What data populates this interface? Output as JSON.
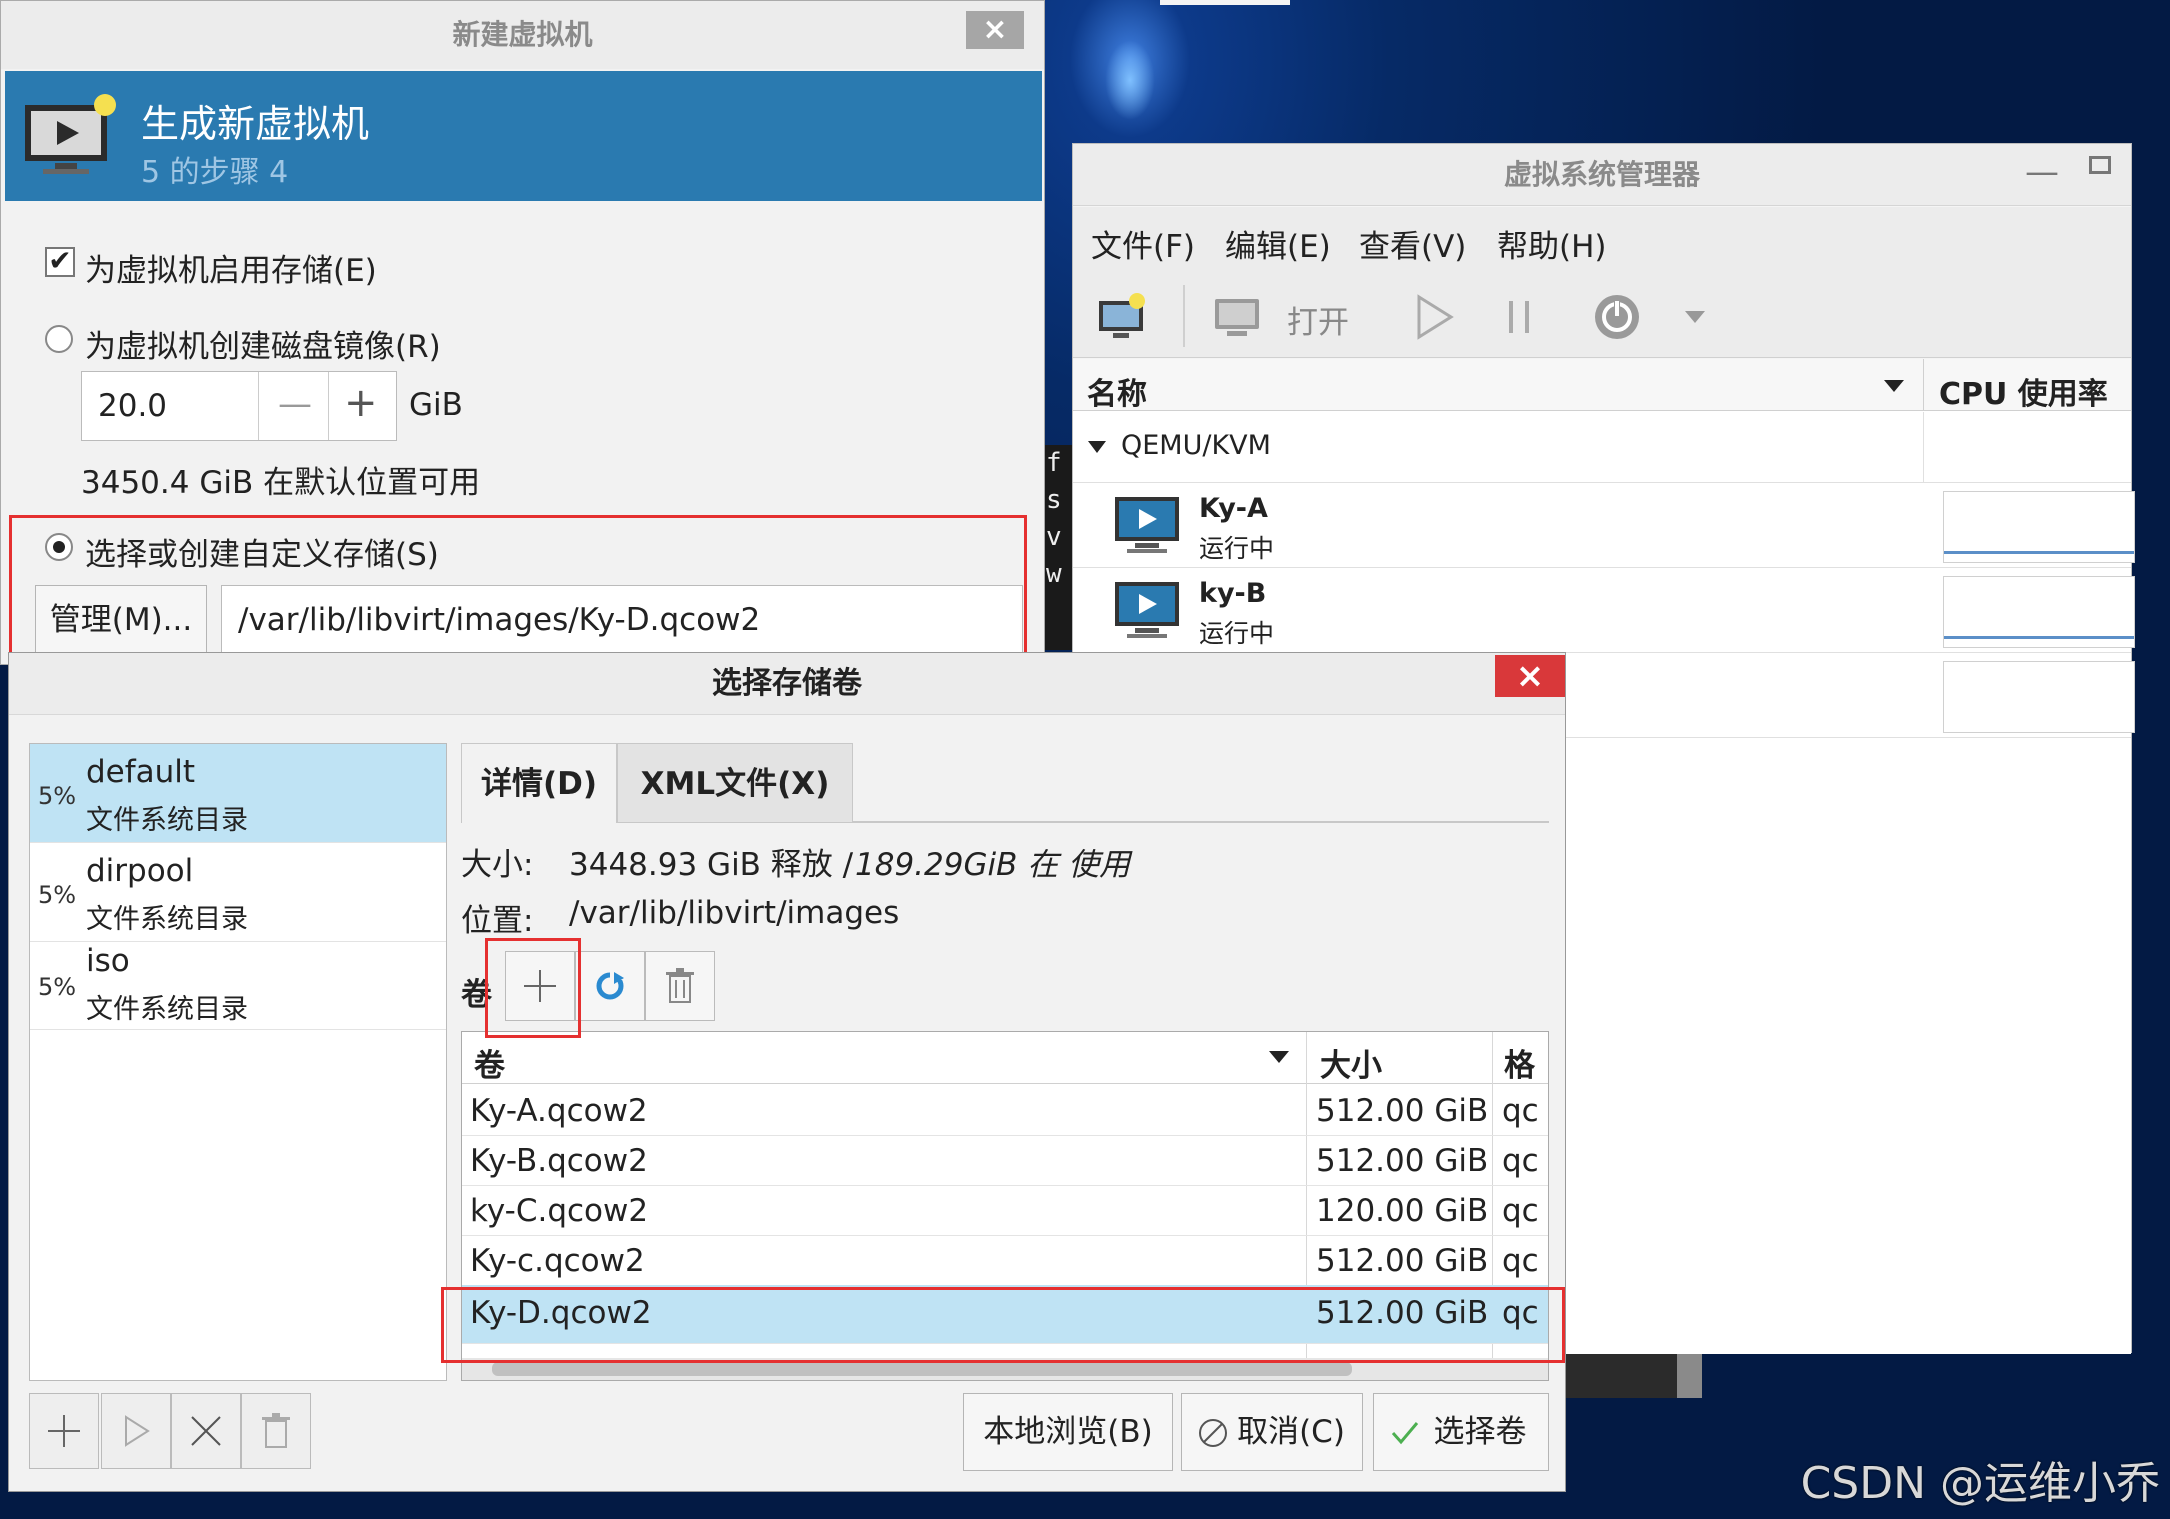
{
  "watermark": "CSDN @运维小乔",
  "terminal_chars": [
    "f",
    "s",
    "v",
    "w"
  ],
  "vmm": {
    "title": "虚拟系统管理器",
    "menu": [
      "文件(F)",
      "编辑(E)",
      "查看(V)",
      "帮助(H)"
    ],
    "toolbar": {
      "open_label": "打开"
    },
    "columns": {
      "name": "名称",
      "cpu": "CPU 使用率"
    },
    "group": "QEMU/KVM",
    "vms": [
      {
        "name": "Ky-A",
        "status": "运行中"
      },
      {
        "name": "ky-B",
        "status": "运行中"
      }
    ]
  },
  "newvm": {
    "title": "新建虚拟机",
    "close_glyph": "×",
    "banner_title": "生成新虚拟机",
    "banner_subtitle": "5 的步骤 4",
    "enable_storage_label": "为虚拟机启用存储(E)",
    "enable_storage_checked": true,
    "create_disk_label": "为虚拟机创建磁盘镜像(R)",
    "disk_size": "20.0",
    "disk_unit": "GiB",
    "available": "3450.4 GiB 在默认位置可用",
    "custom_storage_label": "选择或创建自定义存储(S)",
    "manage_button": "管理(M)...",
    "custom_path": "/var/lib/libvirt/images/Ky-D.qcow2"
  },
  "storage": {
    "title": "选择存储卷",
    "close_glyph": "×",
    "pools": [
      {
        "pct": "5%",
        "name": "default",
        "type": "文件系统目录",
        "selected": true
      },
      {
        "pct": "5%",
        "name": "dirpool",
        "type": "文件系统目录",
        "selected": false
      },
      {
        "pct": "5%",
        "name": "iso",
        "type": "文件系统目录",
        "selected": false
      }
    ],
    "tabs": {
      "details": "详情(D)",
      "xml": "XML文件(X)"
    },
    "size_label": "大小:",
    "size_free": "3448.93 GiB 释放 /",
    "size_used": "189.29GiB 在 使用",
    "location_label": "位置:",
    "location_value": "/var/lib/libvirt/images",
    "volumes_label": "卷",
    "columns": {
      "volume": "卷",
      "size": "大小",
      "format": "格"
    },
    "volumes": [
      {
        "name": "Ky-A.qcow2",
        "size": "512.00 GiB",
        "format": "qc"
      },
      {
        "name": "Ky-B.qcow2",
        "size": "512.00 GiB",
        "format": "qc"
      },
      {
        "name": "ky-C.qcow2",
        "size": "120.00 GiB",
        "format": "qc"
      },
      {
        "name": "Ky-c.qcow2",
        "size": "512.00 GiB",
        "format": "qc"
      },
      {
        "name": "Ky-D.qcow2",
        "size": "512.00 GiB",
        "format": "qc"
      }
    ],
    "selected_volume_index": 4,
    "buttons": {
      "browse": "本地浏览(B)",
      "cancel": "取消(C)",
      "choose": "选择卷"
    }
  }
}
